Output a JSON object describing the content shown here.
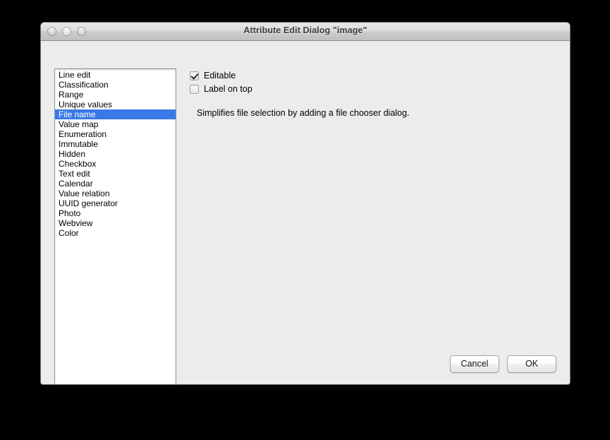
{
  "window": {
    "title": "Attribute Edit Dialog \"image\"",
    "traffic_lights": [
      {
        "name": "close",
        "state": "inactive"
      },
      {
        "name": "minimize",
        "state": "inactive"
      },
      {
        "name": "zoom",
        "state": "inactive"
      }
    ]
  },
  "type_list": {
    "selected": "File name",
    "items": [
      {
        "label": "Line edit",
        "selected": false
      },
      {
        "label": "Classification",
        "selected": false
      },
      {
        "label": "Range",
        "selected": false
      },
      {
        "label": "Unique values",
        "selected": false
      },
      {
        "label": "File name",
        "selected": true
      },
      {
        "label": "Value map",
        "selected": false
      },
      {
        "label": "Enumeration",
        "selected": false
      },
      {
        "label": "Immutable",
        "selected": false
      },
      {
        "label": "Hidden",
        "selected": false
      },
      {
        "label": "Checkbox",
        "selected": false
      },
      {
        "label": "Text edit",
        "selected": false
      },
      {
        "label": "Calendar",
        "selected": false
      },
      {
        "label": "Value relation",
        "selected": false
      },
      {
        "label": "UUID generator",
        "selected": false
      },
      {
        "label": "Photo",
        "selected": false
      },
      {
        "label": "Webview",
        "selected": false
      },
      {
        "label": "Color",
        "selected": false
      }
    ]
  },
  "options": {
    "editable": {
      "label": "Editable",
      "checked": true
    },
    "label_on_top": {
      "label": "Label on top",
      "checked": false
    }
  },
  "description": "Simplifies file selection by adding a file chooser dialog.",
  "buttons": {
    "cancel": "Cancel",
    "ok": "OK"
  },
  "colors": {
    "selection_blue": "#3b78e7",
    "window_background": "#ececec",
    "list_background": "#ffffff",
    "desktop": "#000000"
  }
}
